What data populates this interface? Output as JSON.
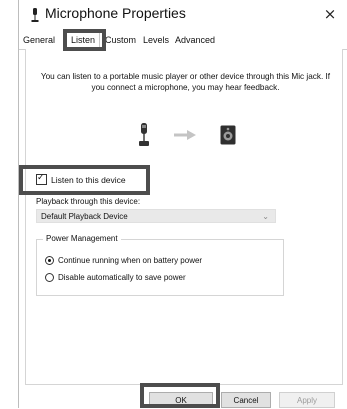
{
  "window": {
    "title": "Microphone Properties",
    "close_glyph": "×"
  },
  "tabs": [
    {
      "label": "General"
    },
    {
      "label": "Listen"
    },
    {
      "label": "Custom"
    },
    {
      "label": "Levels"
    },
    {
      "label": "Advanced"
    }
  ],
  "listen": {
    "description": "You can listen to a portable music player or other device through this Mic jack.  If you connect a microphone, you may hear feedback.",
    "checkbox_label": "Listen to this device",
    "playback_label": "Playback through this device:",
    "playback_value": "Default Playback Device",
    "power_group_title": "Power Management",
    "radio_continue": "Continue running when on battery power",
    "radio_disable": "Disable automatically to save power"
  },
  "buttons": {
    "ok": "OK",
    "cancel": "Cancel",
    "apply": "Apply"
  },
  "icons": {
    "title_icon": "microphone-icon",
    "source_icon": "microphone-icon",
    "arrow": "arrow-right-icon",
    "target_icon": "speaker-icon"
  },
  "colors": {
    "highlight": "#4d4d4d",
    "button_bg": "#e1e1e1"
  }
}
